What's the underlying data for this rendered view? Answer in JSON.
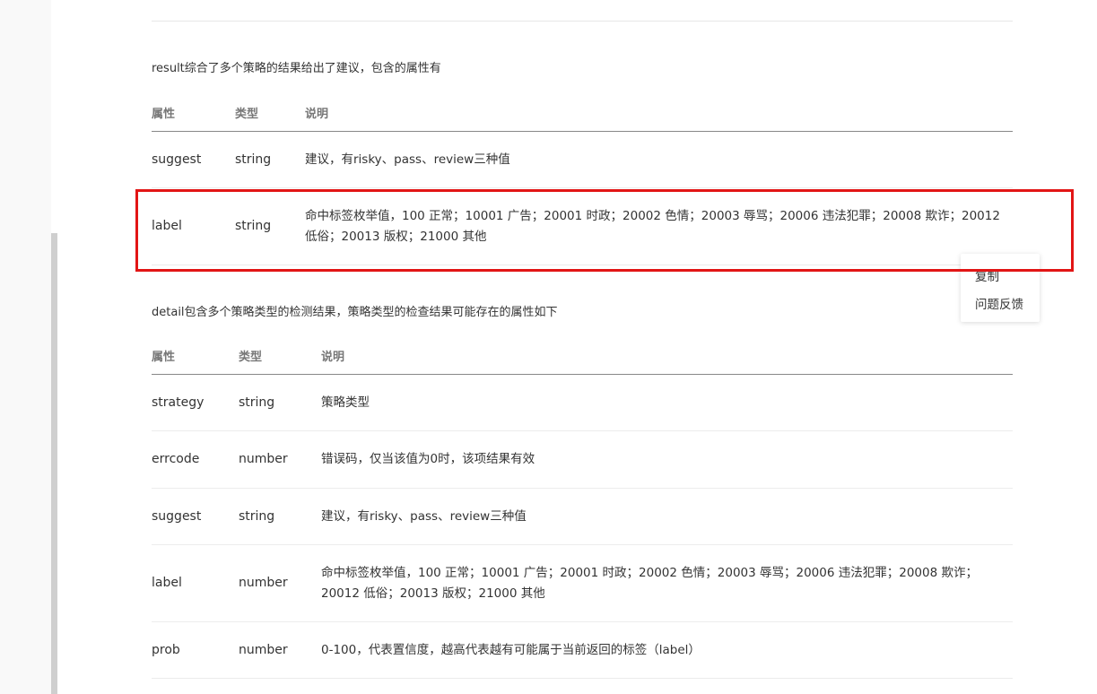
{
  "section1": {
    "intro": "result综合了多个策略的结果给出了建议，包含的属性有",
    "headers": [
      "属性",
      "类型",
      "说明"
    ],
    "rows": [
      {
        "attr": "suggest",
        "type": "string",
        "desc": "建议，有risky、pass、review三种值"
      },
      {
        "attr": "label",
        "type": "string",
        "desc": "命中标签枚举值，100 正常；10001 广告；20001 时政；20002 色情；20003 辱骂；20006 违法犯罪；20008 欺诈；20012 低俗；20013 版权；21000 其他"
      }
    ]
  },
  "section2": {
    "intro": "detail包含多个策略类型的检测结果，策略类型的检查结果可能存在的属性如下",
    "headers": [
      "属性",
      "类型",
      "说明"
    ],
    "rows": [
      {
        "attr": "strategy",
        "type": "string",
        "desc": "策略类型"
      },
      {
        "attr": "errcode",
        "type": "number",
        "desc": "错误码，仅当该值为0时，该项结果有效"
      },
      {
        "attr": "suggest",
        "type": "string",
        "desc": "建议，有risky、pass、review三种值"
      },
      {
        "attr": "label",
        "type": "number",
        "desc": "命中标签枚举值，100 正常；10001 广告；20001 时政；20002 色情；20003 辱骂；20006 违法犯罪；20008 欺诈；20012 低俗；20013 版权；21000 其他"
      },
      {
        "attr": "prob",
        "type": "number",
        "desc": "0-100，代表置信度，越高代表越有可能属于当前返回的标签（label）"
      }
    ]
  },
  "popup": {
    "items": [
      "复制",
      "问题反馈"
    ]
  },
  "colors": {
    "highlight_border": "#e21515",
    "header_text": "#777777",
    "body_text": "#333333"
  }
}
